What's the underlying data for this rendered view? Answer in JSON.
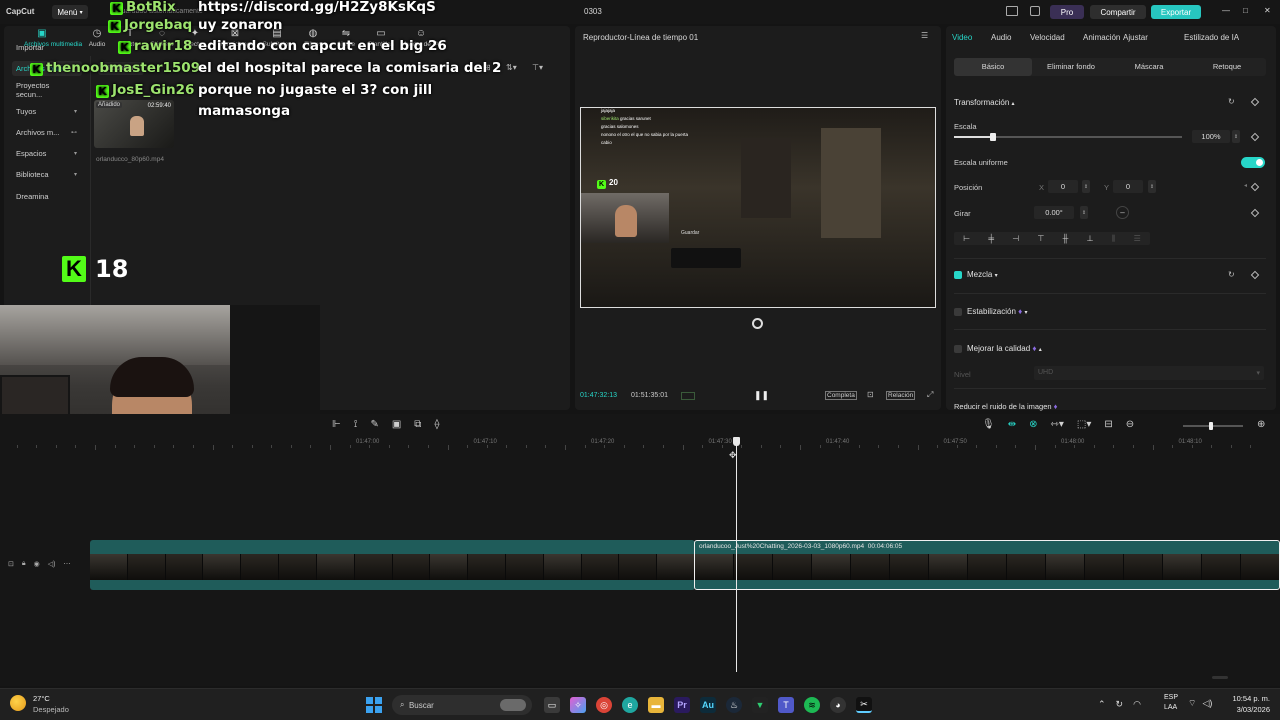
{
  "titlebar": {
    "app_name": "CapCut",
    "menu_label": "Menú",
    "autosave": "Guardado automáticamente",
    "project_name": "0303",
    "pro_label": "Pro",
    "share_label": "Compartir",
    "export_label": "Exportar",
    "minimize": "—",
    "maximize": "□",
    "close": "✕"
  },
  "media_tabs": [
    {
      "label": "Archivos multimedia",
      "icon": "media-icon",
      "glyph": "▣"
    },
    {
      "label": "Audio",
      "icon": "audio-icon",
      "glyph": "◷"
    },
    {
      "label": "Texto",
      "icon": "text-icon",
      "glyph": "T"
    },
    {
      "label": "Stickers",
      "icon": "sticker-icon",
      "glyph": "◌"
    },
    {
      "label": "Efectos",
      "icon": "effects-icon",
      "glyph": "✦"
    },
    {
      "label": "Transiciones",
      "icon": "transition-icon",
      "glyph": "⊠"
    },
    {
      "label": "Subtítulos",
      "icon": "subtitle-icon",
      "glyph": "▤"
    },
    {
      "label": "Filtros",
      "icon": "filter-icon",
      "glyph": "◍"
    },
    {
      "label": "Ajuste",
      "icon": "adjust-icon",
      "glyph": "⇋"
    },
    {
      "label": "Plantillas",
      "icon": "template-icon",
      "glyph": "▭"
    },
    {
      "label": "Avatar de IA",
      "icon": "ai-avatar-icon",
      "glyph": "☺"
    }
  ],
  "sidebar": [
    {
      "label": "Importar",
      "chev": ""
    },
    {
      "label": "Archivos multim...",
      "chev": ""
    },
    {
      "label": "Proyectos secun...",
      "chev": ""
    },
    {
      "label": "Tuyos",
      "chev": "▾"
    },
    {
      "label": "Archivos m...",
      "chev": "⊷"
    },
    {
      "label": "Espacios",
      "chev": "▾"
    },
    {
      "label": "Biblioteca",
      "chev": "▾"
    },
    {
      "label": "Dreamina",
      "chev": ""
    }
  ],
  "media": {
    "import_label": "Importar",
    "added_badge": "Añadido",
    "clip_duration": "02:59:40",
    "clip_name": "orlanducco_80p60.mp4"
  },
  "chat": [
    {
      "nick": "BotRix",
      "msg": "https://discord.gg/H2Zy8KsKqS"
    },
    {
      "nick": "Jorgebaq",
      "msg": "uy zonaron"
    },
    {
      "nick": "rawir18",
      "msg": "editando con capcut en el big 26"
    },
    {
      "nick": "thenoobmaster1509",
      "msg": "el del hospital parece la comisaria del 2"
    },
    {
      "nick": "JosE_Gin26",
      "msg": "porque no jugaste el 3? con jill"
    },
    {
      "nick": "",
      "msg": "mamasonga"
    }
  ],
  "viewer_badge": {
    "count": "18"
  },
  "player": {
    "title": "Reproductor-Línea de tiempo 01",
    "current_time": "01:47:32:13",
    "total_time": "01:51:35:01",
    "complete_label": "Completa",
    "ratio_label": "Relación",
    "inner_viewers": "20",
    "inner_save": "Guardar",
    "inner_chat": [
      {
        "nick": "",
        "msg": "jajajaja"
      },
      {
        "nick": "siberikita",
        "msg": "gracias sarunet"
      },
      {
        "nick": "",
        "msg": "gracias salomones"
      },
      {
        "nick": "",
        "msg": "nonono el otro el que no sabia por la puerta"
      },
      {
        "nick": "",
        "msg": "cabio"
      }
    ]
  },
  "right_panel": {
    "top_tabs": [
      "Video",
      "Audio",
      "Velocidad",
      "Animación",
      "Ajustar",
      "Estilizado de IA"
    ],
    "sub_tabs": [
      "Básico",
      "Eliminar fondo",
      "Máscara",
      "Retoque"
    ],
    "transform_title": "Transformación",
    "scale_label": "Escala",
    "scale_value": "100%",
    "scale_fraction": 0.17,
    "uniform_label": "Escala uniforme",
    "position_label": "Posición",
    "x_label": "X",
    "x_value": "0",
    "y_label": "Y",
    "y_value": "0",
    "rotate_label": "Girar",
    "rotate_value": "0.00°",
    "rotate_dash": "–",
    "blend_label": "Mezcla",
    "stabilize_label": "Estabilización",
    "enhance_label": "Mejorar la calidad",
    "level_label": "Nivel",
    "level_value": "UHD",
    "noise_label": "Reducir el ruido de la imagen",
    "accent": "#27d6c8"
  },
  "timeline": {
    "ruler": [
      "01:47:00",
      "01:47:10",
      "01:47:20",
      "01:47:30",
      "01:47:40",
      "01:47:50",
      "01:48:00",
      "01:48:10"
    ],
    "clip_label": "orlanducoo_Just%20Chatting_2026-03-03_1080p60.mp4",
    "clip_duration": "00:04:06:05"
  },
  "taskbar": {
    "temp": "27°C",
    "weather": "Despejado",
    "search": "Buscar",
    "lang": "ESP",
    "lang2": "LAA",
    "time": "10:54 p. m.",
    "date": "3/03/2026"
  }
}
